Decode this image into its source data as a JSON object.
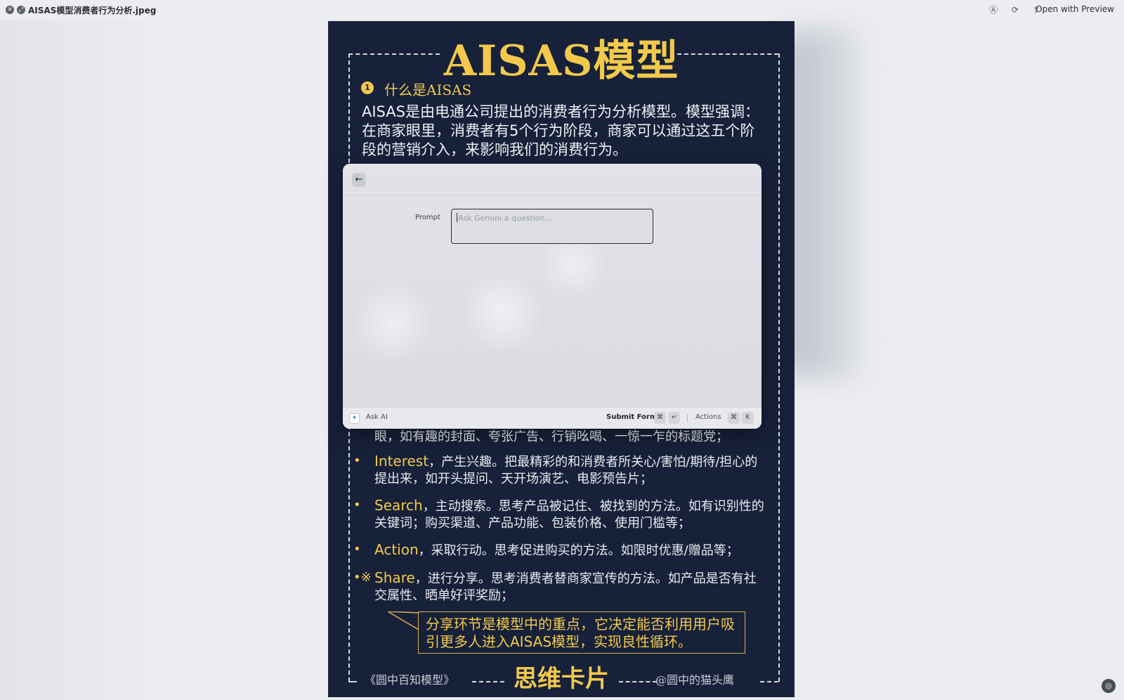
{
  "window": {
    "title": "AISAS模型消费者行为分析.jpeg",
    "open_with": "Open with Preview"
  },
  "poster": {
    "headline": "AISAS模型",
    "section_number": "1",
    "section_title": "什么是AISAS",
    "intro": "AISAS是由电通公司提出的消费者行为分析模型。模型强调：在商家眼里，消费者有5个行为阶段，商家可以通过这五个阶段的营销介入，来影响我们的消费行为。",
    "items": [
      {
        "bullet": "",
        "keyword": "",
        "text": "眼，如有趣的封面、夸张广告、行销吆喝、一惊一乍的标题党；"
      },
      {
        "bullet": "•",
        "keyword": "Interest",
        "text": "，产生兴趣。把最精彩的和消费者所关心/害怕/期待/担心的提出来，如开头提问、天开场演艺、电影预告片；"
      },
      {
        "bullet": "•",
        "keyword": "Search",
        "text": "，主动搜索。思考产品被记住、被找到的方法。如有识别性的关键词；购买渠道、产品功能、包装价格、使用门槛等；"
      },
      {
        "bullet": "•",
        "keyword": "Action",
        "text": "，采取行动。思考促进购买的方法。如限时优惠/赠品等；"
      },
      {
        "bullet": "•※",
        "keyword": "Share",
        "text": "，进行分享。思考消费者替商家宣传的方法。如产品是否有社交属性、晒单好评奖励；"
      }
    ],
    "callout": "分享环节是模型中的重点，它决定能否利用用户吸引更多人进入AISAS模型，实现良性循环。",
    "footer_left": "《圆中百知模型》",
    "footer_center": "思维卡片",
    "footer_right": "@圆中的猫头鹰"
  },
  "ask_ai_panel": {
    "back_icon": "arrow-left-icon",
    "prompt_label": "Prompt",
    "prompt_placeholder": "Ask Gemini a question...",
    "prompt_value": "",
    "footer": {
      "ask_ai": "Ask AI",
      "submit": "Submit Form",
      "submit_keys": [
        "⌘",
        "↵"
      ],
      "actions": "Actions",
      "actions_keys": [
        "⌘",
        "K"
      ]
    }
  },
  "colors": {
    "poster_bg": "#17213a",
    "accent_gold": "#f2c94c",
    "panel_bg": "#dfe1e6"
  }
}
